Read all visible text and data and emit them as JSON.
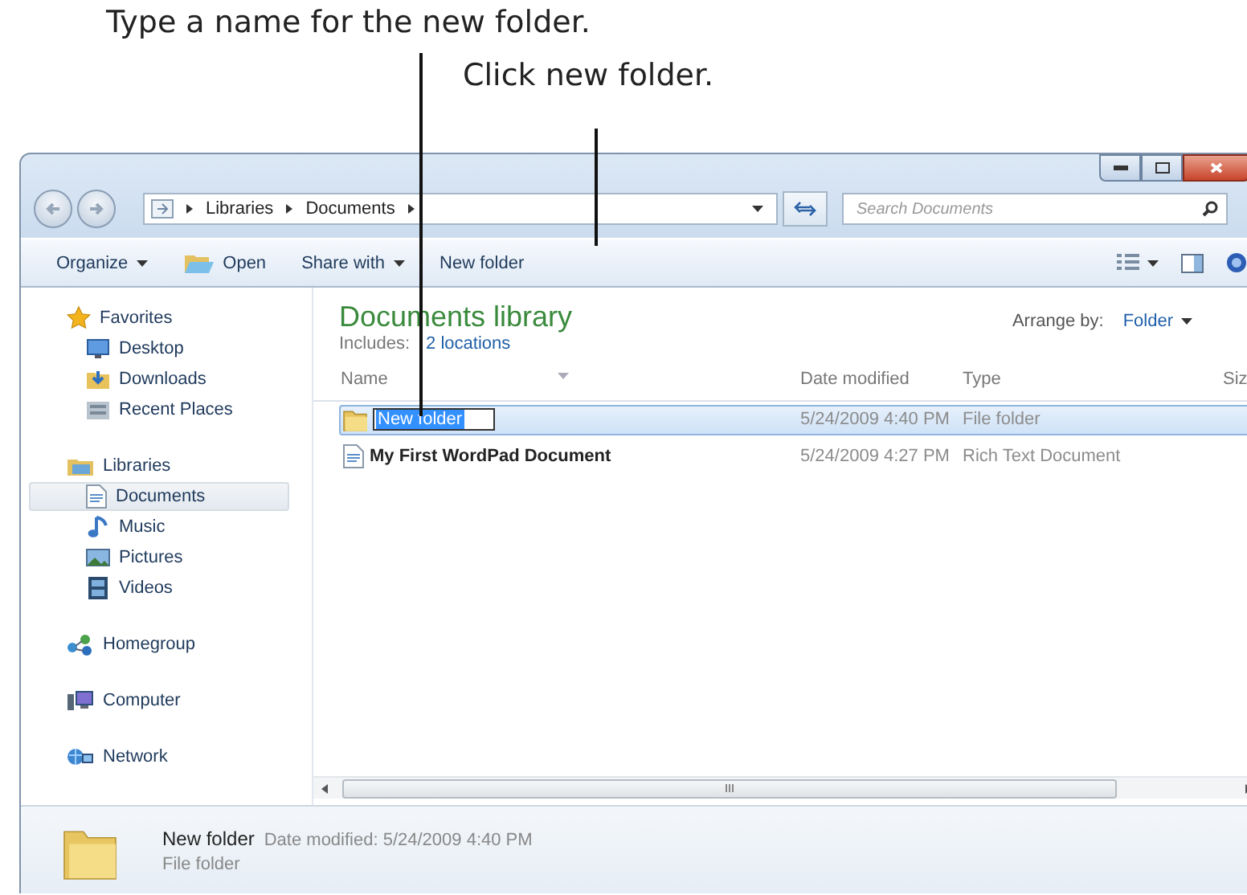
{
  "callouts": [
    {
      "text": "Type a name for the new folder."
    },
    {
      "text": "Click new folder."
    }
  ],
  "address_bar": {
    "path": [
      "Libraries",
      "Documents"
    ]
  },
  "search": {
    "placeholder": "Search Documents"
  },
  "toolbar": {
    "items": [
      {
        "label": "Organize",
        "kind": "menu"
      },
      {
        "label": "Open",
        "kind": "icon"
      },
      {
        "label": "Share with",
        "kind": "menu"
      },
      {
        "label": "New folder",
        "kind": "plain"
      }
    ]
  },
  "nav_pane": {
    "groups": [
      {
        "label": "Favorites",
        "selected": false,
        "children": [
          {
            "label": "Desktop",
            "selected": false
          },
          {
            "label": "Downloads",
            "selected": false
          },
          {
            "label": "Recent Places",
            "selected": false
          }
        ]
      },
      {
        "label": "Libraries",
        "selected": false,
        "children": [
          {
            "label": "Documents",
            "selected": true
          },
          {
            "label": "Music",
            "selected": false
          },
          {
            "label": "Pictures",
            "selected": false
          },
          {
            "label": "Videos",
            "selected": false
          }
        ]
      },
      {
        "label": "Homegroup",
        "selected": false
      },
      {
        "label": "Computer",
        "selected": false
      },
      {
        "label": "Network",
        "selected": false
      }
    ]
  },
  "library": {
    "title": "Documents library",
    "includes_label": "Includes:",
    "locations_link": "2 locations",
    "arrange_label": "Arrange by:",
    "arrange_value": "Folder"
  },
  "file_list": {
    "columns": [
      "Name",
      "Date modified",
      "Type",
      "Siz"
    ],
    "rows": [
      {
        "name": "New folder",
        "kind": "folder",
        "date_modified": "5/24/2009 4:40 PM",
        "type": "File folder",
        "selected": true,
        "editing": true
      },
      {
        "name": "My First WordPad Document",
        "kind": "document",
        "date_modified": "5/24/2009 4:27 PM",
        "type": "Rich Text Document",
        "selected": false,
        "editing": false
      }
    ]
  },
  "details_pane": {
    "name": "New folder",
    "date": "Date modified: 5/24/2009 4:40 PM",
    "type": "File folder"
  }
}
